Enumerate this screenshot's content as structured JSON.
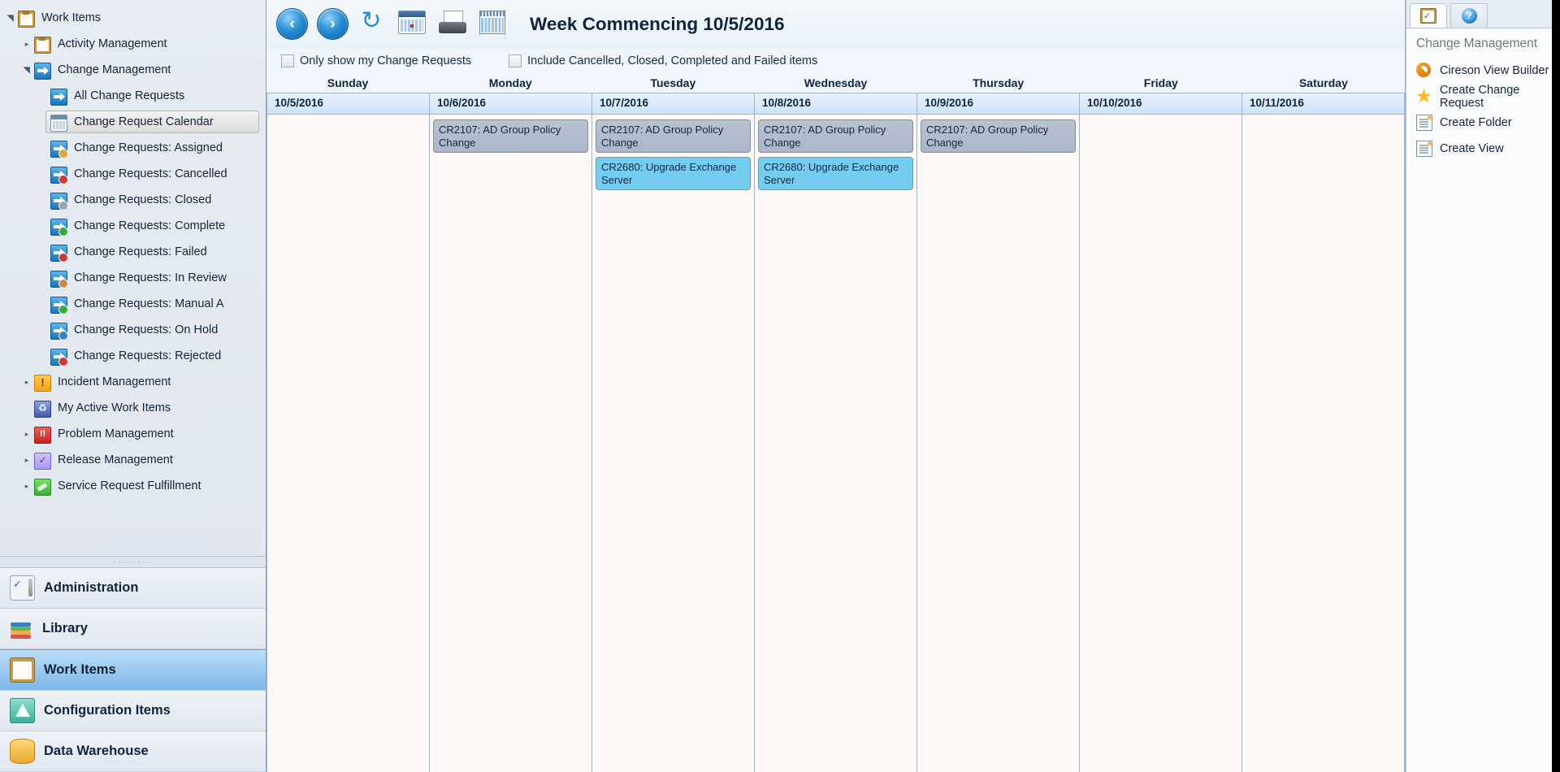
{
  "left_nav": {
    "tree": [
      {
        "label": "Work Items",
        "twist": "down",
        "icon": "clipboard-icon",
        "indent": 0,
        "selected": false
      },
      {
        "label": "Activity Management",
        "twist": "right",
        "icon": "clipboard-icon",
        "indent": 1,
        "selected": false
      },
      {
        "label": "Change Management",
        "twist": "down",
        "icon": "change-arrow-icon",
        "indent": 1,
        "selected": false
      },
      {
        "label": "All Change Requests",
        "twist": "none",
        "icon": "change-arrow-icon",
        "indent": 2,
        "selected": false
      },
      {
        "label": "Change Request Calendar",
        "twist": "none",
        "icon": "calendar-icon",
        "indent": 2,
        "selected": true
      },
      {
        "label": "Change Requests: Assigned",
        "twist": "none",
        "icon": "change-assigned-icon",
        "indent": 2,
        "selected": false
      },
      {
        "label": "Change Requests: Cancelled",
        "twist": "none",
        "icon": "change-cancelled-icon",
        "indent": 2,
        "selected": false
      },
      {
        "label": "Change Requests: Closed",
        "twist": "none",
        "icon": "change-closed-icon",
        "indent": 2,
        "selected": false
      },
      {
        "label": "Change Requests: Complete",
        "twist": "none",
        "icon": "change-complete-icon",
        "indent": 2,
        "selected": false
      },
      {
        "label": "Change Requests: Failed",
        "twist": "none",
        "icon": "change-failed-icon",
        "indent": 2,
        "selected": false
      },
      {
        "label": "Change Requests: In Review",
        "twist": "none",
        "icon": "change-inreview-icon",
        "indent": 2,
        "selected": false
      },
      {
        "label": "Change Requests: Manual A",
        "twist": "none",
        "icon": "change-manual-icon",
        "indent": 2,
        "selected": false
      },
      {
        "label": "Change Requests: On Hold",
        "twist": "none",
        "icon": "change-onhold-icon",
        "indent": 2,
        "selected": false
      },
      {
        "label": "Change Requests: Rejected",
        "twist": "none",
        "icon": "change-rejected-icon",
        "indent": 2,
        "selected": false
      },
      {
        "label": "Incident Management",
        "twist": "right",
        "icon": "incident-icon",
        "indent": 1,
        "selected": false
      },
      {
        "label": "My Active Work Items",
        "twist": "none",
        "icon": "my-active-icon",
        "indent": 1,
        "selected": false
      },
      {
        "label": "Problem Management",
        "twist": "right",
        "icon": "problem-icon",
        "indent": 1,
        "selected": false
      },
      {
        "label": "Release Management",
        "twist": "right",
        "icon": "release-icon",
        "indent": 1,
        "selected": false
      },
      {
        "label": "Service Request Fulfillment",
        "twist": "right",
        "icon": "service-request-icon",
        "indent": 1,
        "selected": false
      }
    ],
    "wunderbar": [
      {
        "label": "Administration",
        "icon": "administration-icon",
        "active": false
      },
      {
        "label": "Library",
        "icon": "library-icon",
        "active": false
      },
      {
        "label": "Work Items",
        "icon": "work-items-icon",
        "active": true
      },
      {
        "label": "Configuration Items",
        "icon": "configuration-items-icon",
        "active": false
      },
      {
        "label": "Data Warehouse",
        "icon": "data-warehouse-icon",
        "active": false
      }
    ]
  },
  "toolbar": {
    "back": "‹",
    "forward": "›",
    "refresh": "↻",
    "today_label": "today-calendar-icon",
    "print_label": "print-icon",
    "pick_date_label": "calendar-picker-icon",
    "title": "Week Commencing 10/5/2016"
  },
  "filters": [
    {
      "label": "Only show my Change Requests",
      "checked": false
    },
    {
      "label": "Include Cancelled, Closed, Completed and Failed items",
      "checked": false
    }
  ],
  "calendar": {
    "day_names": [
      "Sunday",
      "Monday",
      "Tuesday",
      "Wednesday",
      "Thursday",
      "Friday",
      "Saturday"
    ],
    "dates": [
      "10/5/2016",
      "10/6/2016",
      "10/7/2016",
      "10/8/2016",
      "10/9/2016",
      "10/10/2016",
      "10/11/2016"
    ],
    "columns": [
      {
        "date": "10/5/2016",
        "events": []
      },
      {
        "date": "10/6/2016",
        "events": [
          {
            "text": "CR2107: AD Group Policy Change",
            "style": "gray"
          }
        ]
      },
      {
        "date": "10/7/2016",
        "events": [
          {
            "text": "CR2107: AD Group Policy Change",
            "style": "gray"
          },
          {
            "text": "CR2680: Upgrade Exchange Server",
            "style": "blue"
          }
        ]
      },
      {
        "date": "10/8/2016",
        "events": [
          {
            "text": "CR2107: AD Group Policy Change",
            "style": "gray"
          },
          {
            "text": "CR2680: Upgrade Exchange Server",
            "style": "blue"
          }
        ]
      },
      {
        "date": "10/9/2016",
        "events": [
          {
            "text": "CR2107: AD Group Policy Change",
            "style": "gray"
          }
        ]
      },
      {
        "date": "10/10/2016",
        "events": []
      },
      {
        "date": "10/11/2016",
        "events": []
      }
    ],
    "event_colors": {
      "gray": "#b0bdcd",
      "blue": "#74cdf0",
      "border": "#8d9464"
    }
  },
  "task_pane": {
    "tabs": [
      {
        "icon": "tasks-clipboard-icon",
        "active": true
      },
      {
        "icon": "help-icon",
        "label": "?",
        "active": false
      }
    ],
    "header": "Change Management",
    "items": [
      {
        "label": "Cireson View Builder",
        "icon": "cireson-icon",
        "submenu": true
      },
      {
        "label": "Create Change Request",
        "icon": "star-icon",
        "submenu": false
      },
      {
        "label": "Create Folder",
        "icon": "create-folder-icon",
        "submenu": false
      },
      {
        "label": "Create View",
        "icon": "create-view-icon",
        "submenu": false
      }
    ]
  }
}
